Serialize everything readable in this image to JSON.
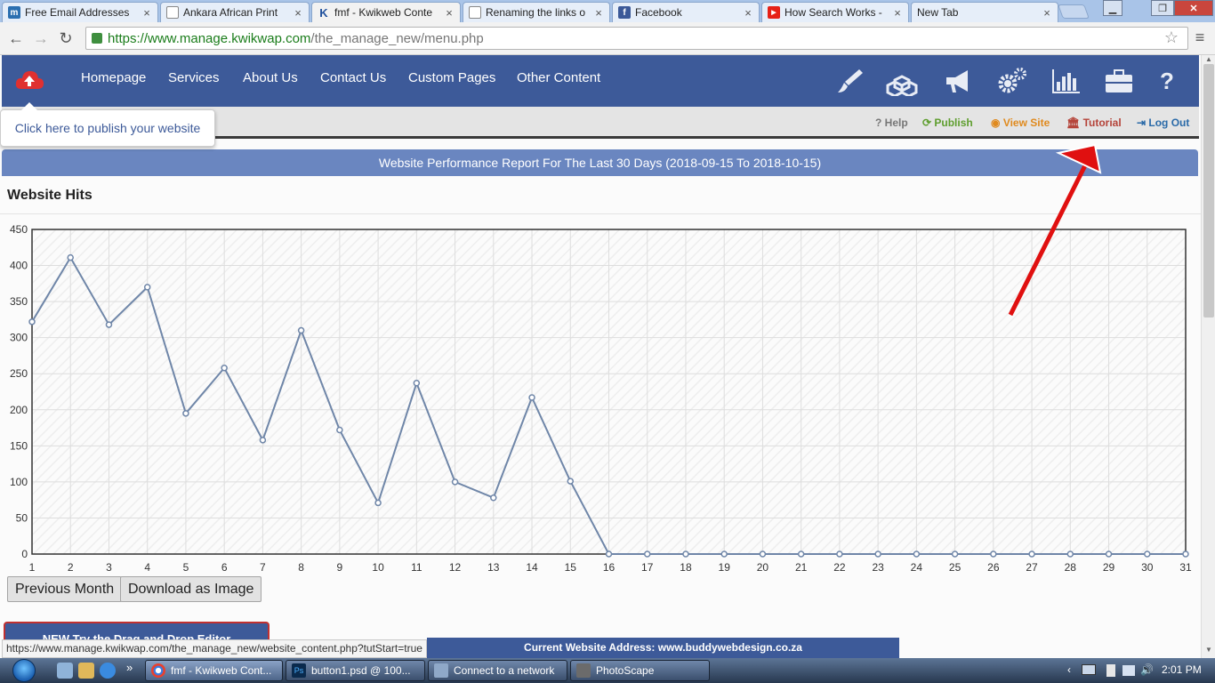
{
  "tabs": [
    {
      "title": "Free Email Addresses",
      "icon": "m-icon"
    },
    {
      "title": "Ankara African Print",
      "icon": "doc-icon"
    },
    {
      "title": "fmf - Kwikweb Conte",
      "icon": "k-icon"
    },
    {
      "title": "Renaming the links o",
      "icon": "doc-icon"
    },
    {
      "title": "Facebook",
      "icon": "facebook-icon"
    },
    {
      "title": "How Search Works -",
      "icon": "youtube-icon"
    },
    {
      "title": "New Tab",
      "icon": "blank-icon"
    }
  ],
  "omnibox": {
    "url_secure": "https://www.manage.kwikwap.com",
    "url_path": "/the_manage_new/menu.php"
  },
  "nav": {
    "items": [
      "Homepage",
      "Services",
      "About Us",
      "Contact Us",
      "Custom Pages",
      "Other Content"
    ],
    "icons": [
      "paintbrush-icon",
      "cubes-icon",
      "megaphone-icon",
      "gears-icon",
      "bar-chart-icon",
      "briefcase-icon",
      "help-icon"
    ]
  },
  "publish_tooltip": "Click here to publish your website",
  "subbar": {
    "help": "Help",
    "publish": "Publish",
    "view_site": "View Site",
    "tutorial": "Tutorial",
    "logout": "Log Out"
  },
  "report_title": "Website Performance Report For The Last 30 Days (2018-09-15 To 2018-10-15)",
  "section_title": "Website Hits",
  "chart_data": {
    "type": "line",
    "title": "",
    "xlabel": "",
    "ylabel": "",
    "x": [
      1,
      2,
      3,
      4,
      5,
      6,
      7,
      8,
      9,
      10,
      11,
      12,
      13,
      14,
      15,
      16,
      17,
      18,
      19,
      20,
      21,
      22,
      23,
      24,
      25,
      26,
      27,
      28,
      29,
      30,
      31
    ],
    "values": [
      322,
      411,
      318,
      370,
      195,
      258,
      158,
      310,
      172,
      71,
      237,
      100,
      78,
      217,
      101,
      0,
      0,
      0,
      0,
      0,
      0,
      0,
      0,
      0,
      0,
      0,
      0,
      0,
      0,
      0,
      0
    ],
    "ylim": [
      0,
      450
    ],
    "yticks": [
      0,
      50,
      100,
      150,
      200,
      250,
      300,
      350,
      400,
      450
    ],
    "grid": true,
    "line_color": "#6f86a8"
  },
  "buttons": {
    "previous_month": "Previous Month",
    "download_image": "Download as Image",
    "drag_drop": "NEW Try the Drag and Drop Editor"
  },
  "current_address": "Current Website Address: www.buddywebdesign.co.za",
  "status_url": "https://www.manage.kwikwap.com/the_manage_new/website_content.php?tutStart=true",
  "taskbar": {
    "items": [
      {
        "label": "fmf - Kwikweb Cont...",
        "icon": "chrome-icon"
      },
      {
        "label": "button1.psd @ 100...",
        "icon": "photoshop-icon"
      },
      {
        "label": "Connect to a network",
        "icon": "network-icon"
      },
      {
        "label": "PhotoScape",
        "icon": "photoscape-icon"
      }
    ],
    "clock": "2:01 PM"
  },
  "colors": {
    "brand_blue": "#3d5a99",
    "report_bar": "#6a86c0",
    "publish_green": "#5f9e2f",
    "view_site_orange": "#e08a1e",
    "tutorial_red": "#b5443a",
    "logout_blue": "#2a6aa8",
    "arrow_red": "#e01010"
  }
}
